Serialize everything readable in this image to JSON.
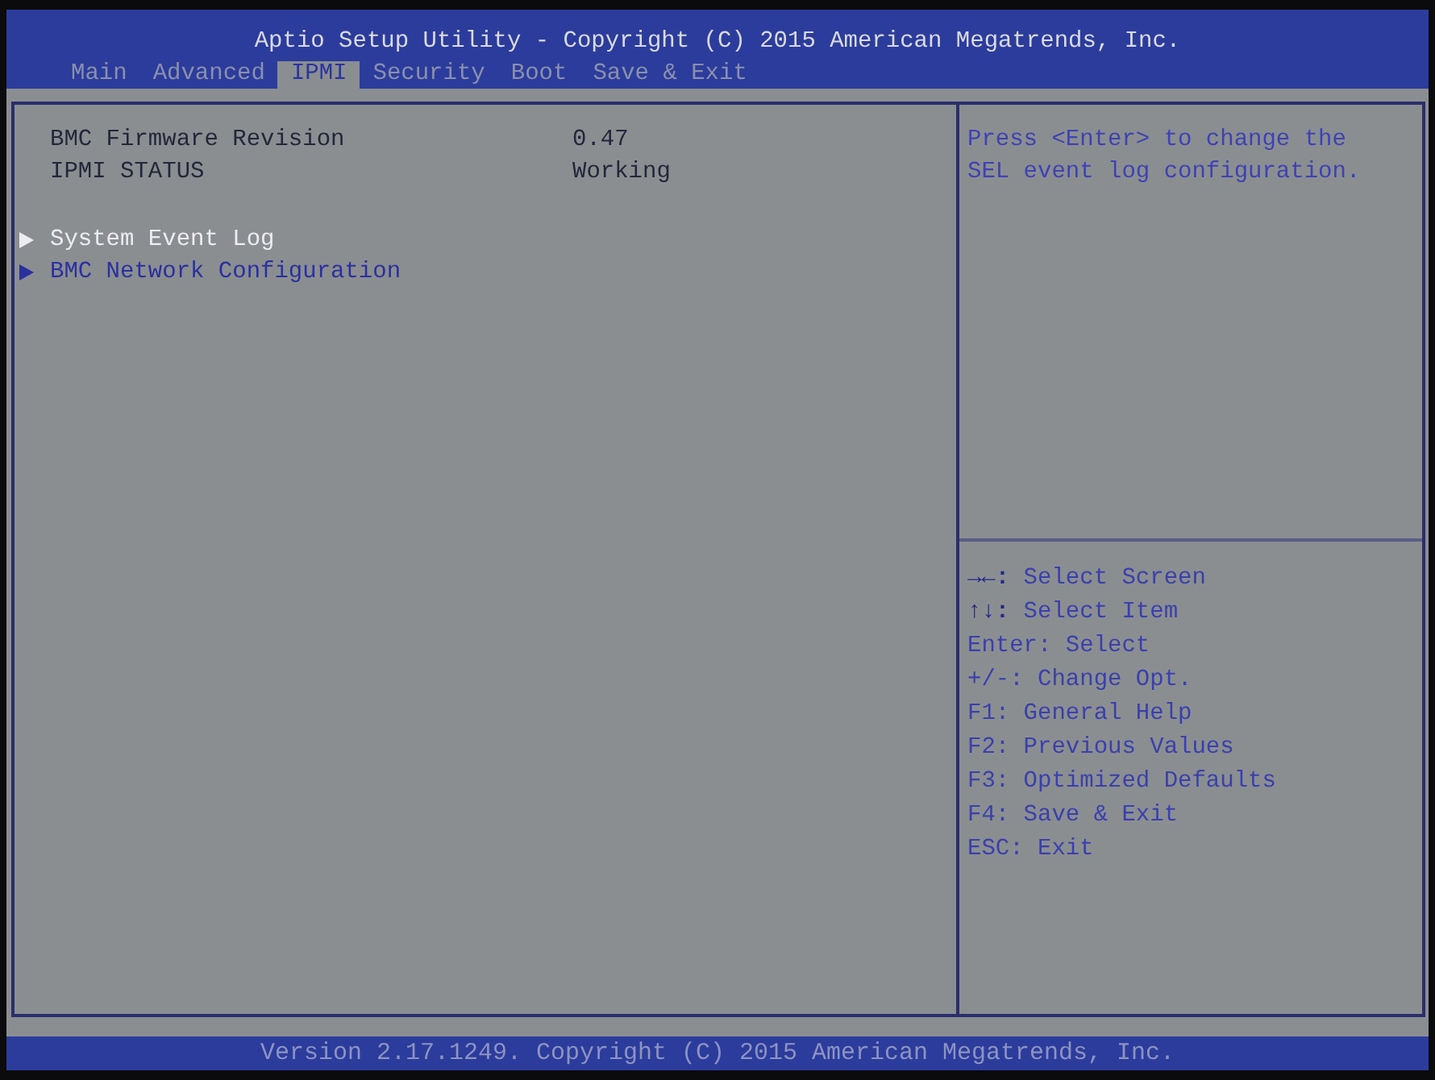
{
  "window": {
    "title": "Aptio Setup Utility - Copyright (C) 2015 American Megatrends, Inc."
  },
  "tabs": [
    {
      "label": "Main",
      "selected": false
    },
    {
      "label": "Advanced",
      "selected": false
    },
    {
      "label": "IPMI",
      "selected": true
    },
    {
      "label": "Security",
      "selected": false
    },
    {
      "label": "Boot",
      "selected": false
    },
    {
      "label": "Save & Exit",
      "selected": false
    }
  ],
  "info": [
    {
      "label": "BMC Firmware Revision",
      "value": "0.47"
    },
    {
      "label": "IPMI STATUS",
      "value": "Working"
    }
  ],
  "submenus": [
    {
      "label": "System Event Log",
      "selected": true
    },
    {
      "label": "BMC Network Configuration",
      "selected": false
    }
  ],
  "help_text": "Press <Enter> to change the SEL event log configuration.",
  "key_hints": [
    "**→←:** Select Screen",
    "**↑↓:** Select Item",
    "Enter: Select",
    "+/-: Change Opt.",
    "F1: General Help",
    "F2: Previous Values",
    "F3: Optimized Defaults",
    "F4: Save & Exit",
    "ESC: Exit"
  ],
  "status_bar": "Version 2.17.1249. Copyright (C) 2015 American Megatrends, Inc."
}
